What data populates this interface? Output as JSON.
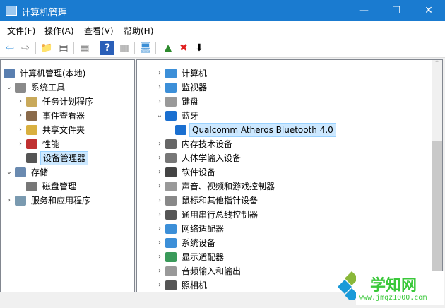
{
  "window": {
    "title": "计算机管理",
    "controls": [
      "—",
      "☐",
      "✕"
    ]
  },
  "menu": [
    "文件(F)",
    "操作(A)",
    "查看(V)",
    "帮助(H)"
  ],
  "toolbar": [
    {
      "icon": "back-arrow-icon",
      "g": "⇦",
      "c": "#2a8ad8"
    },
    {
      "icon": "forward-arrow-icon",
      "g": "⇨",
      "c": "#888"
    },
    {
      "icon": "up-folder-icon",
      "g": "📁",
      "c": "#d9a520"
    },
    {
      "icon": "show-hide-tree-icon",
      "g": "▤",
      "c": "#555"
    },
    {
      "icon": "properties-icon",
      "g": "▦",
      "c": "#888"
    },
    {
      "icon": "help-icon",
      "g": "?",
      "c": "#fff"
    },
    {
      "icon": "action-pane-icon",
      "g": "▥",
      "c": "#555"
    },
    {
      "icon": "scan-hardware-icon",
      "g": "🖥",
      "c": "#3b8fd6"
    },
    {
      "icon": "update-driver-icon",
      "g": "▲",
      "c": "#2d8a2d"
    },
    {
      "icon": "uninstall-icon",
      "g": "✖",
      "c": "#e02020"
    },
    {
      "icon": "disable-device-icon",
      "g": "⬇",
      "c": "#000"
    }
  ],
  "left_tree": [
    {
      "label": "计算机管理(本地)",
      "lvl": 0,
      "ex": "",
      "ic": "#5a7fb0"
    },
    {
      "label": "系统工具",
      "lvl": 1,
      "ex": "⌄",
      "ic": "#8a8a8a"
    },
    {
      "label": "任务计划程序",
      "lvl": 2,
      "ex": "›",
      "ic": "#c9a95a"
    },
    {
      "label": "事件查看器",
      "lvl": 2,
      "ex": "›",
      "ic": "#8a6a4a"
    },
    {
      "label": "共享文件夹",
      "lvl": 2,
      "ex": "›",
      "ic": "#d9b040"
    },
    {
      "label": "性能",
      "lvl": 2,
      "ex": "›",
      "ic": "#c03030"
    },
    {
      "label": "设备管理器",
      "lvl": 2,
      "ex": "",
      "ic": "#555",
      "sel": true
    },
    {
      "label": "存储",
      "lvl": 1,
      "ex": "⌄",
      "ic": "#6a8ab0"
    },
    {
      "label": "磁盘管理",
      "lvl": 2,
      "ex": "",
      "ic": "#777"
    },
    {
      "label": "服务和应用程序",
      "lvl": 1,
      "ex": "›",
      "ic": "#7a9ab0"
    }
  ],
  "devices": [
    {
      "label": "计算机",
      "ex": "›",
      "ic": "#3c8fd8"
    },
    {
      "label": "监视器",
      "ex": "›",
      "ic": "#3c8fd8"
    },
    {
      "label": "键盘",
      "ex": "›",
      "ic": "#999"
    },
    {
      "label": "蓝牙",
      "ex": "⌄",
      "ic": "#1a6fd0"
    },
    {
      "label": "Qualcomm Atheros Bluetooth 4.0",
      "ex": "",
      "ic": "#1a6fd0",
      "child": true,
      "sel": true
    },
    {
      "label": "内存技术设备",
      "ex": "›",
      "ic": "#666"
    },
    {
      "label": "人体学输入设备",
      "ex": "›",
      "ic": "#777"
    },
    {
      "label": "软件设备",
      "ex": "›",
      "ic": "#444"
    },
    {
      "label": "声音、视频和游戏控制器",
      "ex": "›",
      "ic": "#999"
    },
    {
      "label": "鼠标和其他指针设备",
      "ex": "›",
      "ic": "#888"
    },
    {
      "label": "通用串行总线控制器",
      "ex": "›",
      "ic": "#555"
    },
    {
      "label": "网络适配器",
      "ex": "›",
      "ic": "#3c8fd8"
    },
    {
      "label": "系统设备",
      "ex": "›",
      "ic": "#3c8fd8"
    },
    {
      "label": "显示适配器",
      "ex": "›",
      "ic": "#3a9a5a"
    },
    {
      "label": "音频输入和输出",
      "ex": "›",
      "ic": "#999"
    },
    {
      "label": "照相机",
      "ex": "›",
      "ic": "#555"
    }
  ],
  "watermark": {
    "name": "学知网",
    "url": "www.jmqz1000.com"
  }
}
